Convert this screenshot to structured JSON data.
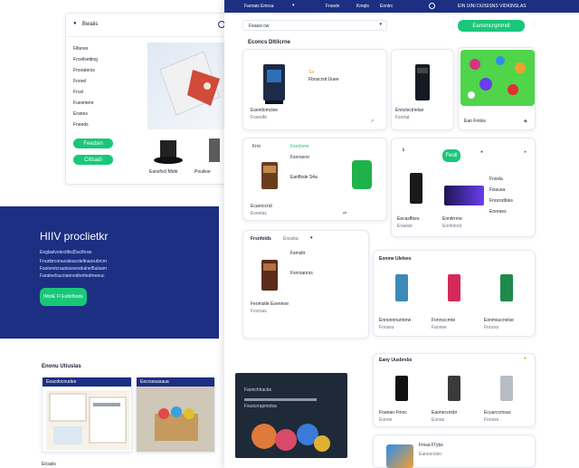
{
  "colors": {
    "navy": "#1c2f83",
    "green": "#19c77a",
    "bg": "#ffffff"
  },
  "back_window": {
    "title": "Bwaiis",
    "nav": [
      "Filteres",
      "Frcellsetting",
      "Fnoraterss",
      "Fnorel",
      "Frcel",
      "Fuesmere",
      "Eranes",
      "Fneeds"
    ],
    "btn1": "Feedsin",
    "btn2": "Cltlsadi",
    "promo_item": "Eansfocl Mobi",
    "promo_item2": "Pouilesr"
  },
  "hero": {
    "heading": "HIIV proclietkr",
    "line1": "Eeglaslvolecttlisi|5ucthran",
    "line2": "Fnunbrconucaleacstelinaorubrcm",
    "line3": "Fasisretcrautssuvesdulnel5ulsam",
    "line4": "Faraleelsucnannodnettedmeeuc",
    "button": "IMotE Fl Eolbtfbnds"
  },
  "topbar": {
    "brand": "Fanrais Emrsa",
    "links": [
      "Frsedv",
      "Kmqls",
      "Enntrc"
    ],
    "right_text": "EIN UINI DUISISNS VIDKINSLAS"
  },
  "toolbar": {
    "select": "Feassi cw",
    "add_button": "Eansmcnpnmdl"
  },
  "sec1": {
    "title": "Econcs Dltilcrne",
    "p1_label": "Esentlomclee",
    "p1_price": "Fosrelkt",
    "p1_detail": "Fbnscrsit Uuee",
    "p1_tag": "Sa",
    "p2_label": "Enoclectrlelan",
    "p2_price": "Fsnrtat",
    "p3_label": "Ean Fmlos"
  },
  "sec2": {
    "t1": "Frni",
    "t2": "Feerlsms",
    "p1_name": "Fsnrsersr",
    "p1_sub": "Eanfbsle S4a",
    "p1_a": "Ecaroccnd",
    "p1_b": "Eveetac",
    "p2_a": "Eecasflbes",
    "p2_b": "Eraesie",
    "p3_a": "Ennitrrrne",
    "p3_b": "Ennhinrst",
    "chip": "Feoll",
    "list": [
      "Fnssla",
      "Fissusa",
      "Fnocorlbles",
      "Enoraes"
    ]
  },
  "sec3": {
    "tab1": "Frsnfolds",
    "tab2": "Enssba",
    "p1_a": "Fsmsltr",
    "p1_b": "Fsnrsanrss",
    "p1_c": "Feomstle Eoennoe",
    "p1_d": "Fosrsas"
  },
  "sec4": {
    "title": "Eonme Ulelees",
    "items": [
      {
        "a": "Ennonnnurlrerw",
        "b": "Fonses"
      },
      {
        "a": "Fonrsccmte",
        "b": "Fannee"
      },
      {
        "a": "Eonmsucnelse",
        "b": "Fnnces"
      }
    ]
  },
  "sec5": {
    "title": "Eany Uusbrsbs",
    "items": [
      {
        "a": "Foanao Fmoc",
        "b": "Eonoe"
      },
      {
        "a": "Eaonecorsbr",
        "b": "Eonas"
      },
      {
        "a": "Ecuurccmsuc",
        "b": "Fonsss"
      }
    ],
    "bottom_title": "Fmsa Fl'ybs",
    "bottom_sub": "Eanovrclen"
  },
  "lower_left": {
    "title": "Enonu Utiuslas",
    "card1_header": "Eeacdocnudee",
    "card2_header": "Eecrsesasaua",
    "footer": "Elcasls"
  },
  "dark_card": {
    "line1": "Faonchhacbs",
    "line2": "Fsuscrrapmotsa"
  }
}
